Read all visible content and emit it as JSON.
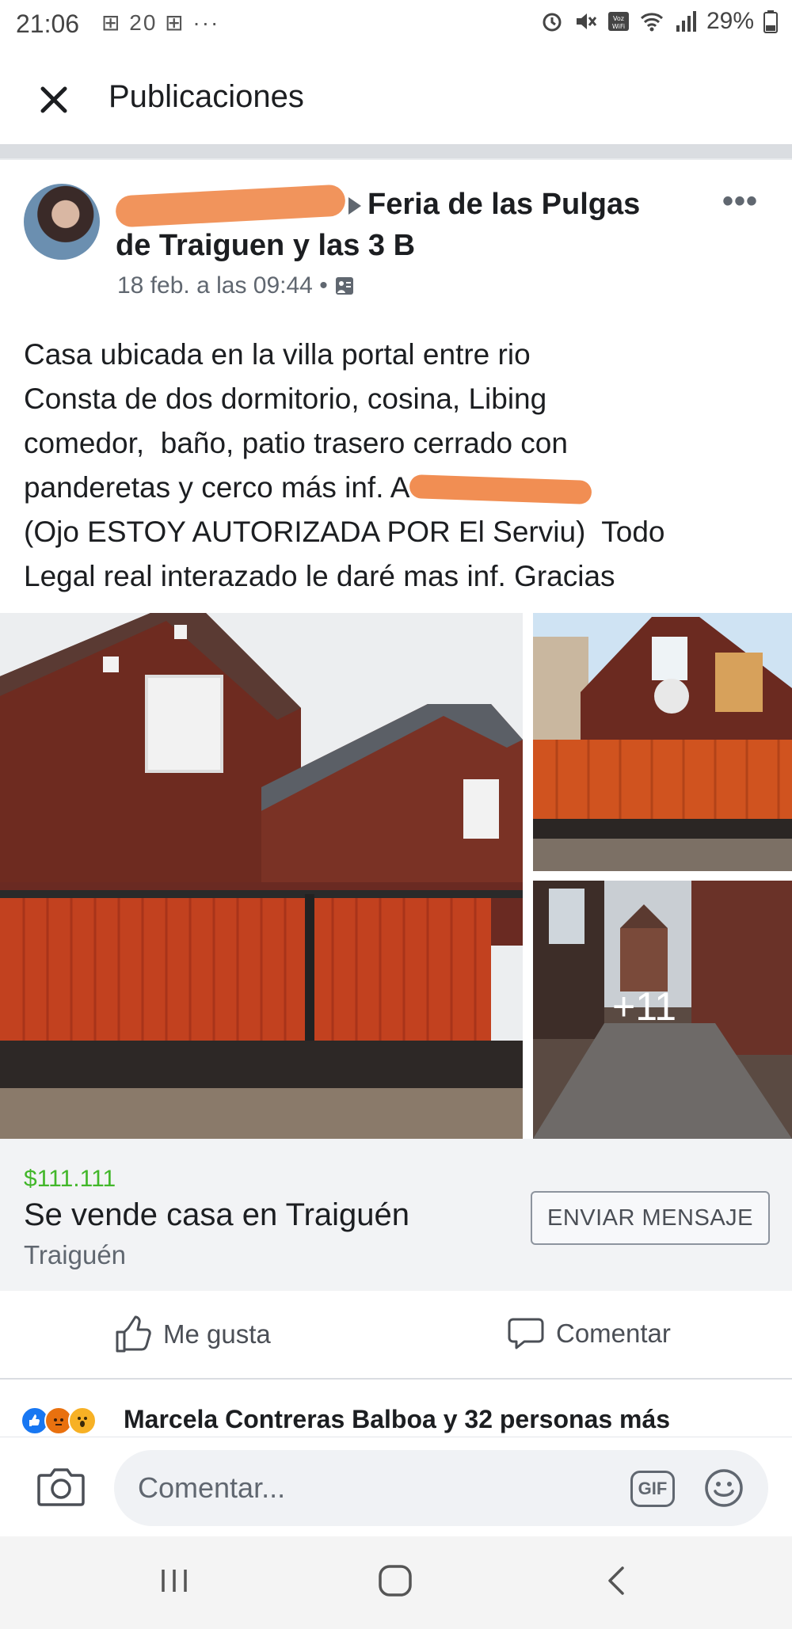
{
  "status_bar": {
    "time": "21:06",
    "notifications": "⊞ 20 ⊞ ···",
    "battery": "29%"
  },
  "header": {
    "title": "Publicaciones"
  },
  "post": {
    "group_name_line1": "Feria de las Pulgas",
    "group_name_line2": "de Traiguen y las 3 B",
    "timestamp": "18 feb. a las 09:44 •",
    "text_lines": [
      "Casa ubicada en la villa portal entre rio",
      "Consta de dos dormitorio, cosina, Libing",
      "comedor,  baño, patio trasero cerrado con",
      "panderetas y cerco más inf. A",
      "(Ojo ESTOY AUTORIZADA POR El Serviu)  Todo",
      "Legal real interazado le daré mas inf. Gracias"
    ],
    "more_photos": "+11"
  },
  "listing": {
    "price": "$111.111",
    "title": "Se vende casa en Traiguén",
    "location": "Traiguén",
    "message_button": "ENVIAR MENSAJE"
  },
  "actions": {
    "like": "Me gusta",
    "comment": "Comentar"
  },
  "reactions": {
    "summary": "Marcela Contreras Balboa y 32 personas más"
  },
  "comment_bar": {
    "placeholder": "Comentar...",
    "gif": "GIF"
  },
  "colors": {
    "price": "#42b72a",
    "facebook_blue": "#1877f2",
    "redaction": "#f0884a"
  }
}
